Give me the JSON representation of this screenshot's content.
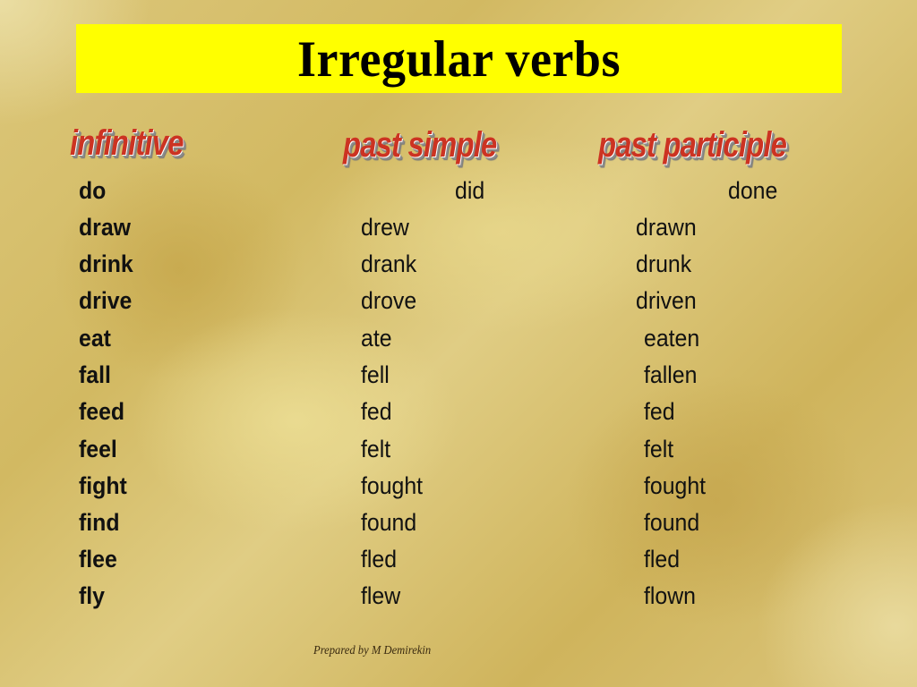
{
  "title": "Irregular verbs",
  "columns": {
    "infinitive": "infinitive",
    "past_simple": "past simple",
    "past_participle": "past participle"
  },
  "verbs": [
    {
      "infinitive": "do",
      "past_simple": "did",
      "past_participle": "done"
    },
    {
      "infinitive": "draw",
      "past_simple": "drew",
      "past_participle": "drawn"
    },
    {
      "infinitive": "drink",
      "past_simple": "drank",
      "past_participle": "drunk"
    },
    {
      "infinitive": "drive",
      "past_simple": "drove",
      "past_participle": "driven"
    },
    {
      "infinitive": "eat",
      "past_simple": "ate",
      "past_participle": "eaten"
    },
    {
      "infinitive": "fall",
      "past_simple": "fell",
      "past_participle": "fallen"
    },
    {
      "infinitive": "feed",
      "past_simple": "fed",
      "past_participle": "fed"
    },
    {
      "infinitive": "feel",
      "past_simple": "felt",
      "past_participle": "felt"
    },
    {
      "infinitive": "fight",
      "past_simple": "fought",
      "past_participle": "fought"
    },
    {
      "infinitive": "find",
      "past_simple": "found",
      "past_participle": "found"
    },
    {
      "infinitive": "flee",
      "past_simple": "fled",
      "past_participle": "fled"
    },
    {
      "infinitive": "fly",
      "past_simple": "flew",
      "past_participle": "flown"
    }
  ],
  "footer": "Prepared by M Demirekin",
  "colors": {
    "title_bar": "#ffff00",
    "column_heading": "#cc3322"
  }
}
